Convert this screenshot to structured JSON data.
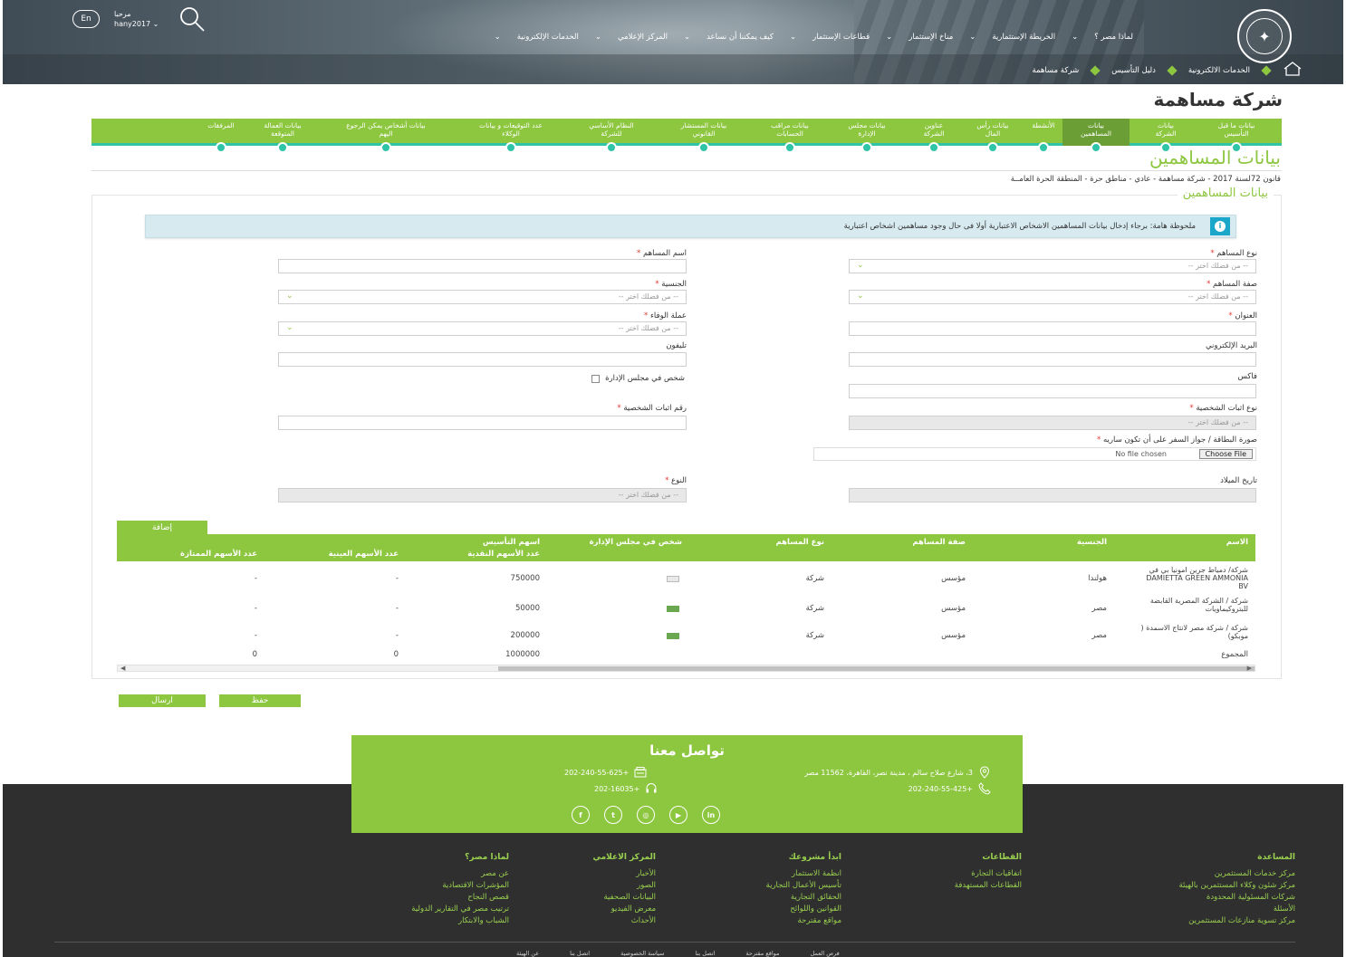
{
  "header": {
    "lang_button": "En",
    "greeting": "مرحبا",
    "username": "hany2017",
    "nav": [
      "لماذا مصر ؟",
      "الخريطة الإستثمارية",
      "مناخ الإستثمار",
      "قطاعات الإستثمار",
      "كيف يمكننا أن نساعد",
      "المركز الإعلامي",
      "الخدمات الإلكترونية"
    ],
    "breadcrumb": [
      "الخدمات الالكترونية",
      "دليل التأسيس",
      "شركة مساهمة"
    ]
  },
  "page_title": "شركة مساهمة",
  "steps": [
    {
      "label": "بيانات ما قبل\nالتأسيس",
      "active": false
    },
    {
      "label": "بيانات\nالشركة",
      "active": false
    },
    {
      "label": "بيانات\nالمساهمين",
      "active": true
    },
    {
      "label": "الأنشطة",
      "active": false
    },
    {
      "label": "بيانات رأس\nالمال",
      "active": false
    },
    {
      "label": "عناوين\nالشركة",
      "active": false
    },
    {
      "label": "بيانات مجلس\nالإدارة",
      "active": false
    },
    {
      "label": "بيانات مراقب\nالحسابات",
      "active": false
    },
    {
      "label": "بيانات المستشار\nالقانوني",
      "active": false
    },
    {
      "label": "النظام الأساسي\nللشركة",
      "active": false
    },
    {
      "label": "عدد التوقيعات و بيانات\nالوكلاء",
      "active": false
    },
    {
      "label": "بيانات أشخاص يمكن الرجوع\nاليهم",
      "active": false
    },
    {
      "label": "بيانات العمالة\nالمتوقعة",
      "active": false
    },
    {
      "label": "المرفقات",
      "active": false
    }
  ],
  "section_title": "بيانات المساهمين",
  "subtitle": "قانون 72لسنة 2017 - شركة مساهمة - عادي - مناطق حرة - المنطقة الحرة العامــة",
  "card_legend": "بيانات المساهمين",
  "note": "ملحوظة هامة: برجاء إدخال بيانات المساهمين الاشخاص الاعتبارية أولا فى حال وجود مساهمين اشخاص اعتبارية",
  "form": {
    "placeholder_select": "-- من فضلك اختر --",
    "shareholder_type": "نوع المساهم",
    "shareholder_name": "اسم المساهم",
    "shareholder_capacity": "صفة المساهم",
    "nationality": "الجنسية",
    "address": "العنوان",
    "payment_currency": "عملة الوفاء",
    "email": "البريد الإلكتروني",
    "phone": "تليفون",
    "fax": "فاكس",
    "board_member": "شخص في مجلس الإدارة",
    "id_type": "نوع اثبات الشخصية",
    "id_number": "رقم اثبات الشخصية",
    "id_image": "صورة البطاقة / جواز السفر على أن تكون ساريه",
    "choose_file": "Choose File",
    "no_file": "No file chosen",
    "birth_date": "تاريخ الميلاد",
    "gender": "النوع"
  },
  "table": {
    "add_button": "إضافة",
    "headers": {
      "name": "الاسم",
      "nationality": "الجنسية",
      "capacity": "صفة المساهم",
      "type": "نوع المساهم",
      "board": "شخص في مجلس الإدارة",
      "founding_shares": "اسهم التأسيس",
      "cash_shares": "عدد الأسهم النقدية",
      "inkind_shares": "عدد الأسهم العينية",
      "preferred_shares": "عدد الأسهم الممتازة"
    },
    "rows": [
      {
        "name": "شركة/ دمياط جرين امونيا بي في DAMIETTA GREEN AMMONIA BV",
        "nationality": "هولندا",
        "capacity": "مؤسس",
        "type": "شركة",
        "board": false,
        "cash": "750000",
        "inkind": "-",
        "preferred": "-"
      },
      {
        "name": "شركة / الشركة المصرية القابضة للبتروكيماويات",
        "nationality": "مصر",
        "capacity": "مؤسس",
        "type": "شركة",
        "board": true,
        "cash": "50000",
        "inkind": "-",
        "preferred": "-"
      },
      {
        "name": "شركة / شركة مصر لانتاج الاسمدة ( موبكو)",
        "nationality": "مصر",
        "capacity": "مؤسس",
        "type": "شركة",
        "board": true,
        "cash": "200000",
        "inkind": "-",
        "preferred": "-"
      }
    ],
    "total_label": "المجموع",
    "total_cash": "1000000",
    "total_inkind": "0",
    "total_preferred": "0"
  },
  "buttons": {
    "save": "حفظ",
    "send": "ارسال"
  },
  "contact": {
    "title": "تواصل معنا",
    "address": "3، شارع صلاح سالم ، مدينة نصر، القاهرة، 11562 مصر",
    "fax": "+202-240-55-625",
    "phone": "+202-240-55-425",
    "hotline": "+202-16035"
  },
  "footer": {
    "columns": [
      {
        "heading": "المساعدة",
        "items": [
          "مركز خدمات المستثمرين",
          "مركز شئون وكلاء المستثمرين بالهيئة",
          "شركات المسئولية المحدودة",
          "الأسئلة",
          "مركز تسوية منازعات المستثمرين"
        ]
      },
      {
        "heading": "القطاعات",
        "items": [
          "اتفاقيات التجارة",
          "القطاعات المستهدفة"
        ]
      },
      {
        "heading": "ابدأ مشروعك",
        "items": [
          "انظمة الاستثمار",
          "تأسيس الأعمال التجارية",
          "الحقائق التجارية",
          "القوانين واللوائح",
          "مواقع مقترحة"
        ]
      },
      {
        "heading": "المركز الاعلامي",
        "items": [
          "الأخبار",
          "الصور",
          "البيانات الصحفية",
          "معرض الفيديو",
          "الأحداث"
        ]
      },
      {
        "heading": "لماذا مصر؟",
        "items": [
          "عن مصر",
          "المؤشرات الاقتصادية",
          "قصص النجاح",
          "ترتيب مصر في التقارير الدولية",
          "الشباب والابتكار"
        ]
      }
    ],
    "bottom_links": [
      "فرص العمل",
      "مواقع مقترحة",
      "اتصل بنا",
      "سياسة الخصوصية",
      "اتصل بنا",
      "عن الهيئة"
    ]
  },
  "colors": {
    "accent": "#8dc63f",
    "teal": "#2fc4a8",
    "footer_bg": "#2f2f2f",
    "note_bg": "#d7eaf0"
  }
}
